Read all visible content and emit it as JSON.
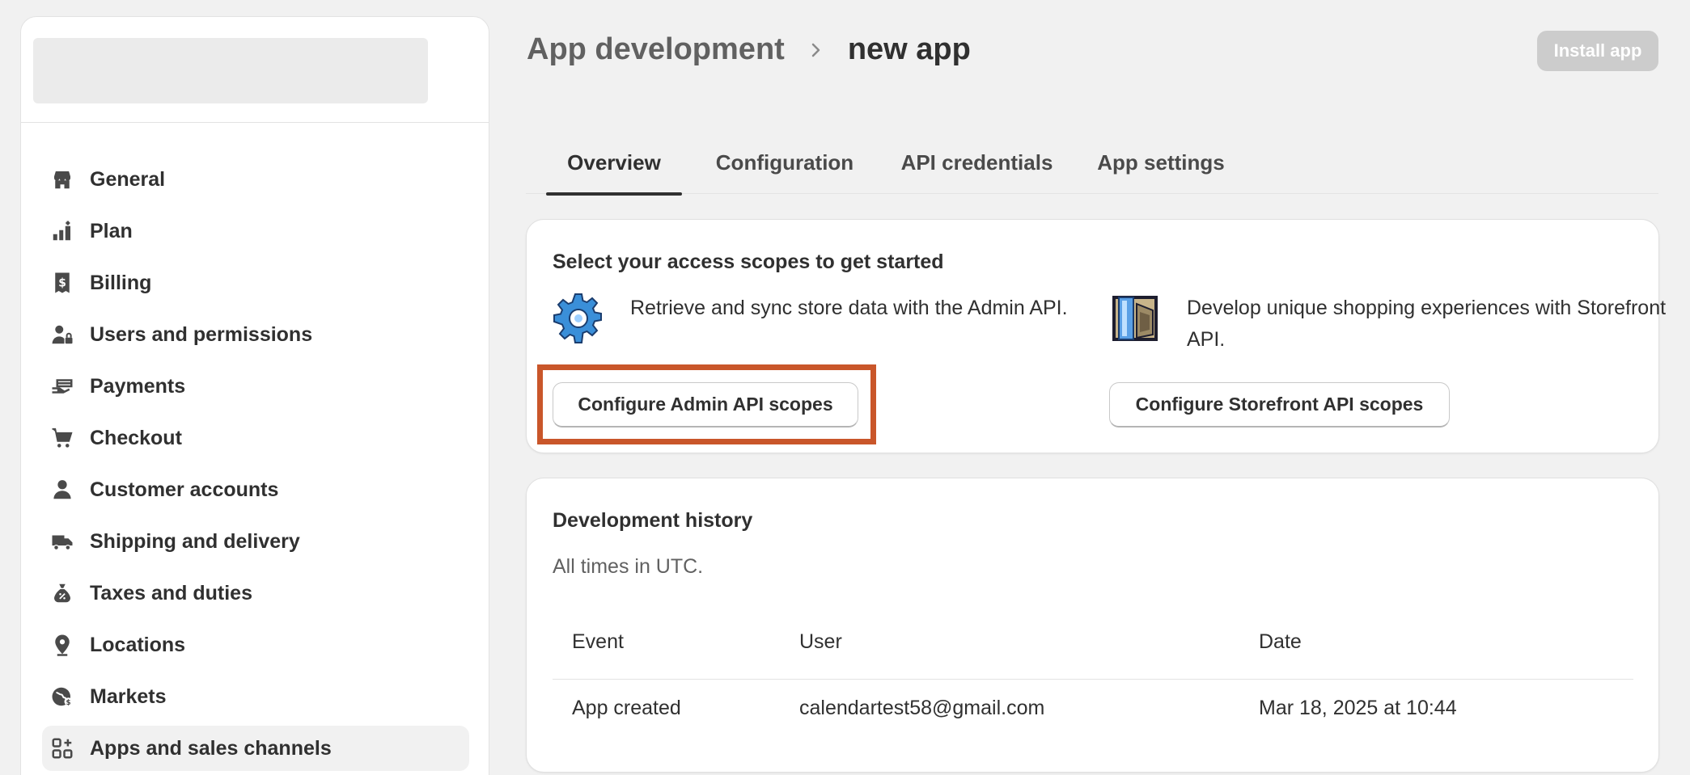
{
  "sidebar": {
    "items": [
      {
        "label": "General",
        "icon": "store-icon"
      },
      {
        "label": "Plan",
        "icon": "plan-icon"
      },
      {
        "label": "Billing",
        "icon": "billing-icon"
      },
      {
        "label": "Users and permissions",
        "icon": "users-icon"
      },
      {
        "label": "Payments",
        "icon": "payments-icon"
      },
      {
        "label": "Checkout",
        "icon": "cart-icon"
      },
      {
        "label": "Customer accounts",
        "icon": "person-icon"
      },
      {
        "label": "Shipping and delivery",
        "icon": "truck-icon"
      },
      {
        "label": "Taxes and duties",
        "icon": "tax-bag-icon"
      },
      {
        "label": "Locations",
        "icon": "location-pin-icon"
      },
      {
        "label": "Markets",
        "icon": "globe-icon"
      },
      {
        "label": "Apps and sales channels",
        "icon": "apps-icon",
        "active": true
      }
    ]
  },
  "header": {
    "breadcrumb_parent": "App development",
    "breadcrumb_current": "new app",
    "install_label": "Install app"
  },
  "tabs": [
    {
      "label": "Overview",
      "active": true
    },
    {
      "label": "Configuration"
    },
    {
      "label": "API credentials"
    },
    {
      "label": "App settings"
    }
  ],
  "scopes_card": {
    "title": "Select your access scopes to get started",
    "admin": {
      "description": "Retrieve and sync store data with the Admin API.",
      "button": "Configure Admin API scopes",
      "icon": "gear-icon"
    },
    "storefront": {
      "description": "Develop unique shopping experiences with Storefront API.",
      "button": "Configure Storefront API scopes",
      "icon": "storefront-icon"
    }
  },
  "history_card": {
    "title": "Development history",
    "subtitle": "All times in UTC.",
    "columns": [
      "Event",
      "User",
      "Date"
    ],
    "rows": [
      {
        "event": "App created",
        "user": "calendartest58@gmail.com",
        "date": "Mar 18, 2025 at 10:44"
      }
    ]
  },
  "colors": {
    "highlight": "#c9562a",
    "install_disabled": "#cccccc"
  }
}
